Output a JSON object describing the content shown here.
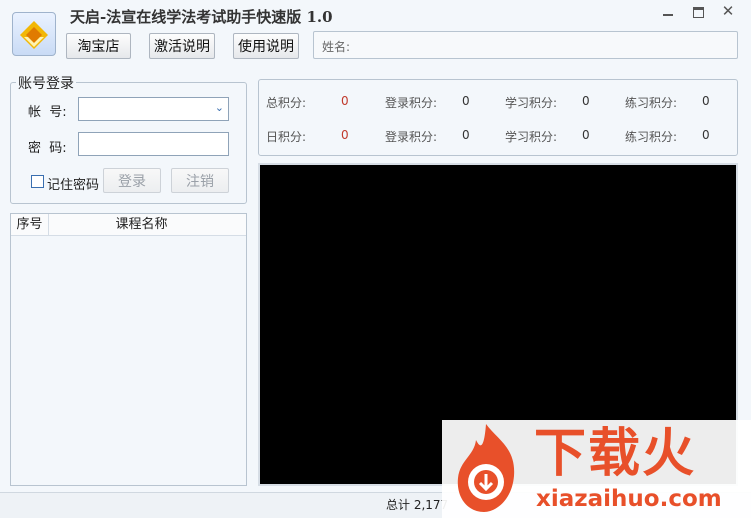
{
  "app": {
    "title": "天启-法宣在线学法考试助手快速版 1.0"
  },
  "toolbar": {
    "taobao_label": "淘宝店",
    "activate_label": "激活说明",
    "usage_label": "使用说明",
    "name_label": "姓名:"
  },
  "login": {
    "group_title": "账号登录",
    "account_label": "帐  号:",
    "account_value": "",
    "password_label": "密  码:",
    "password_value": "",
    "remember_label": "记住密码",
    "login_label": "登录",
    "logout_label": "注销"
  },
  "course_table": {
    "col_index": "序号",
    "col_name": "课程名称"
  },
  "scores": {
    "row1": [
      {
        "label": "总积分:",
        "value": "0"
      },
      {
        "label": "登录积分:",
        "value": "0"
      },
      {
        "label": "学习积分:",
        "value": "0"
      },
      {
        "label": "练习积分:",
        "value": "0"
      }
    ],
    "row2": [
      {
        "label": "日积分:",
        "value": "0"
      },
      {
        "label": "登录积分:",
        "value": "0"
      },
      {
        "label": "学习积分:",
        "value": "0"
      },
      {
        "label": "练习积分:",
        "value": "0"
      }
    ]
  },
  "status": {
    "text": "总计 2,177"
  },
  "watermark": {
    "brand": "下载火",
    "domain": "xiazaihuo.com"
  },
  "colors": {
    "accent_red": "#c0392b",
    "watermark_orange": "#e8502a"
  }
}
